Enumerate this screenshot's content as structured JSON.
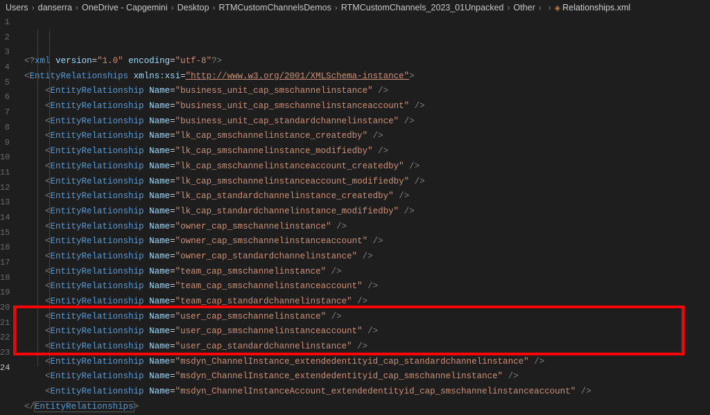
{
  "breadcrumb": [
    "Users",
    "danserra",
    "OneDrive - Capgemini",
    "Desktop",
    "RTMCustomChannelsDemos",
    "RTMCustomChannels_2023_01Unpacked",
    "Other",
    "",
    "Relationships.xml"
  ],
  "xmlDecl": {
    "version": "1.0",
    "encoding": "utf-8"
  },
  "root": {
    "tag": "EntityRelationships",
    "nsAttr": "xmlns:xsi",
    "nsVal": "http://www.w3.org/2001/XMLSchema-instance"
  },
  "childTag": "EntityRelationship",
  "childAttr": "Name",
  "relationships": [
    "business_unit_cap_smschannelinstance",
    "business_unit_cap_smschannelinstanceaccount",
    "business_unit_cap_standardchannelinstance",
    "lk_cap_smschannelinstance_createdby",
    "lk_cap_smschannelinstance_modifiedby",
    "lk_cap_smschannelinstanceaccount_createdby",
    "lk_cap_smschannelinstanceaccount_modifiedby",
    "lk_cap_standardchannelinstance_createdby",
    "lk_cap_standardchannelinstance_modifiedby",
    "owner_cap_smschannelinstance",
    "owner_cap_smschannelinstanceaccount",
    "owner_cap_standardchannelinstance",
    "team_cap_smschannelinstance",
    "team_cap_smschannelinstanceaccount",
    "team_cap_standardchannelinstance",
    "user_cap_smschannelinstance",
    "user_cap_smschannelinstanceaccount",
    "user_cap_standardchannelinstance",
    "msdyn_ChannelInstance_extendedentityid_cap_standardchannelinstance",
    "msdyn_ChannelInstance_extendedentityid_cap_smschannelinstance",
    "msdyn_ChannelInstanceAccount_extendedentityid_cap_smschannelinstanceaccount"
  ],
  "lineStart": 1,
  "activeLine": 24
}
